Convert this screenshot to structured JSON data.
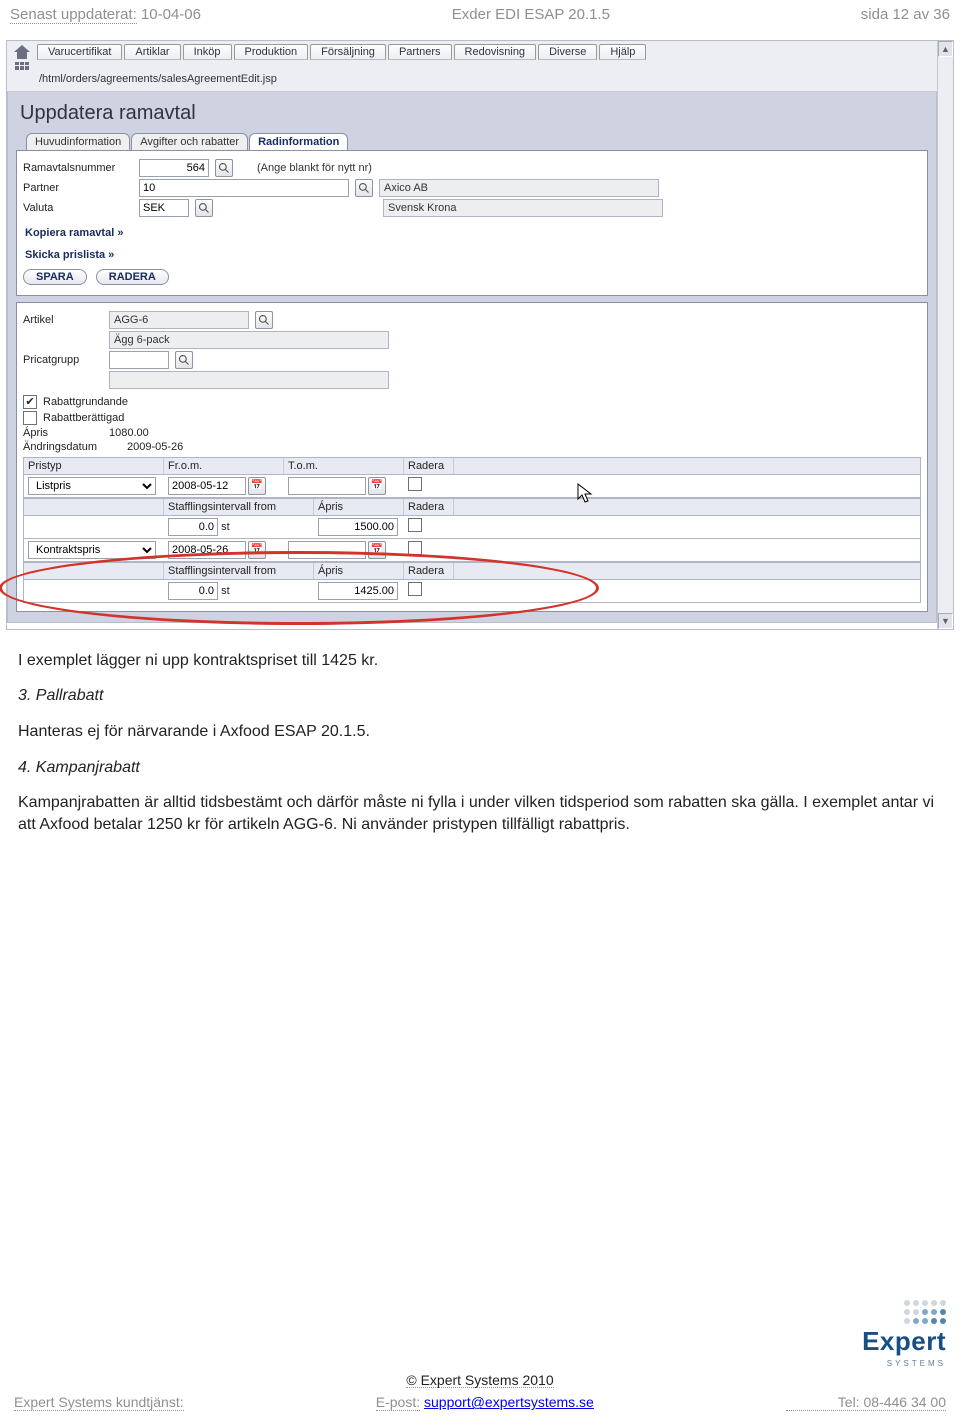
{
  "doc_header": {
    "left_label": "Senast uppdaterat:",
    "left_value": "10-04-06",
    "center": "Exder EDI ESAP 20.1.5",
    "right": "sida 12 av 36"
  },
  "menu": {
    "items": [
      "Varucertifikat",
      "Artiklar",
      "Inköp",
      "Produktion",
      "Försäljning",
      "Partners",
      "Redovisning",
      "Diverse",
      "Hjälp"
    ]
  },
  "path": "/html/orders/agreements/salesAgreementEdit.jsp",
  "page_title": "Uppdatera ramavtal",
  "subtabs": [
    "Huvudinformation",
    "Avgifter och rabatter",
    "Radinformation"
  ],
  "form": {
    "ramavtal_label": "Ramavtalsnummer",
    "ramavtal_value": "564",
    "ramavtal_hint": "(Ange blankt för nytt nr)",
    "partner_label": "Partner",
    "partner_value": "10",
    "partner_name": "Axico AB",
    "valuta_label": "Valuta",
    "valuta_value": "SEK",
    "valuta_name": "Svensk Krona"
  },
  "links": {
    "kopiera": "Kopiera ramavtal »",
    "skicka": "Skicka prislista »"
  },
  "buttons": {
    "spara": "SPARA",
    "radera": "RADERA"
  },
  "article": {
    "artikel_label": "Artikel",
    "artikel_code": "AGG-6",
    "artikel_name": "Ägg 6-pack",
    "pricat_label": "Pricatgrupp",
    "rabattgrund_label": "Rabattgrundande",
    "rabattber_label": "Rabattberättigad",
    "apris_label": "Ápris",
    "apris_value": "1080.00",
    "andring_label": "Ändringsdatum",
    "andring_value": "2009-05-26"
  },
  "price_table": {
    "hdr_pristyp": "Pristyp",
    "hdr_from": "Fr.o.m.",
    "hdr_tom": "T.o.m.",
    "hdr_radera": "Radera",
    "sub_hdr_interval": "Stafflingsintervall from",
    "sub_hdr_apris": "Ápris",
    "unit": "st",
    "rows": [
      {
        "type": "Listpris",
        "from": "2008-05-12",
        "tom": "",
        "interval": "0.0",
        "price": "1500.00"
      },
      {
        "type": "Kontraktspris",
        "from": "2008-05-26",
        "tom": "",
        "interval": "0.0",
        "price": "1425.00"
      }
    ]
  },
  "doc_text": {
    "p1": "I exemplet lägger ni upp kontraktspriset till 1425 kr.",
    "h3": "3. Pallrabatt",
    "p3": "Hanteras ej för närvarande i Axfood ESAP 20.1.5.",
    "h4": "4. Kampanjrabatt",
    "p4": "Kampanjrabatten är alltid tidsbestämt och därför måste ni fylla i under vilken tidsperiod som rabatten ska gälla. I exemplet antar vi att Axfood betalar 1250 kr för artikeln AGG-6. Ni använder pristypen tillfälligt rabattpris."
  },
  "footer": {
    "copyright": "© Expert Systems 2010",
    "left": "Expert Systems kundtjänst:",
    "mid_label": "E-post:",
    "mid_link": "support@expertsystems.se",
    "right": "Tel: 08-446 34 00",
    "brand": "Expert",
    "brand_sub": "SYSTEMS"
  }
}
